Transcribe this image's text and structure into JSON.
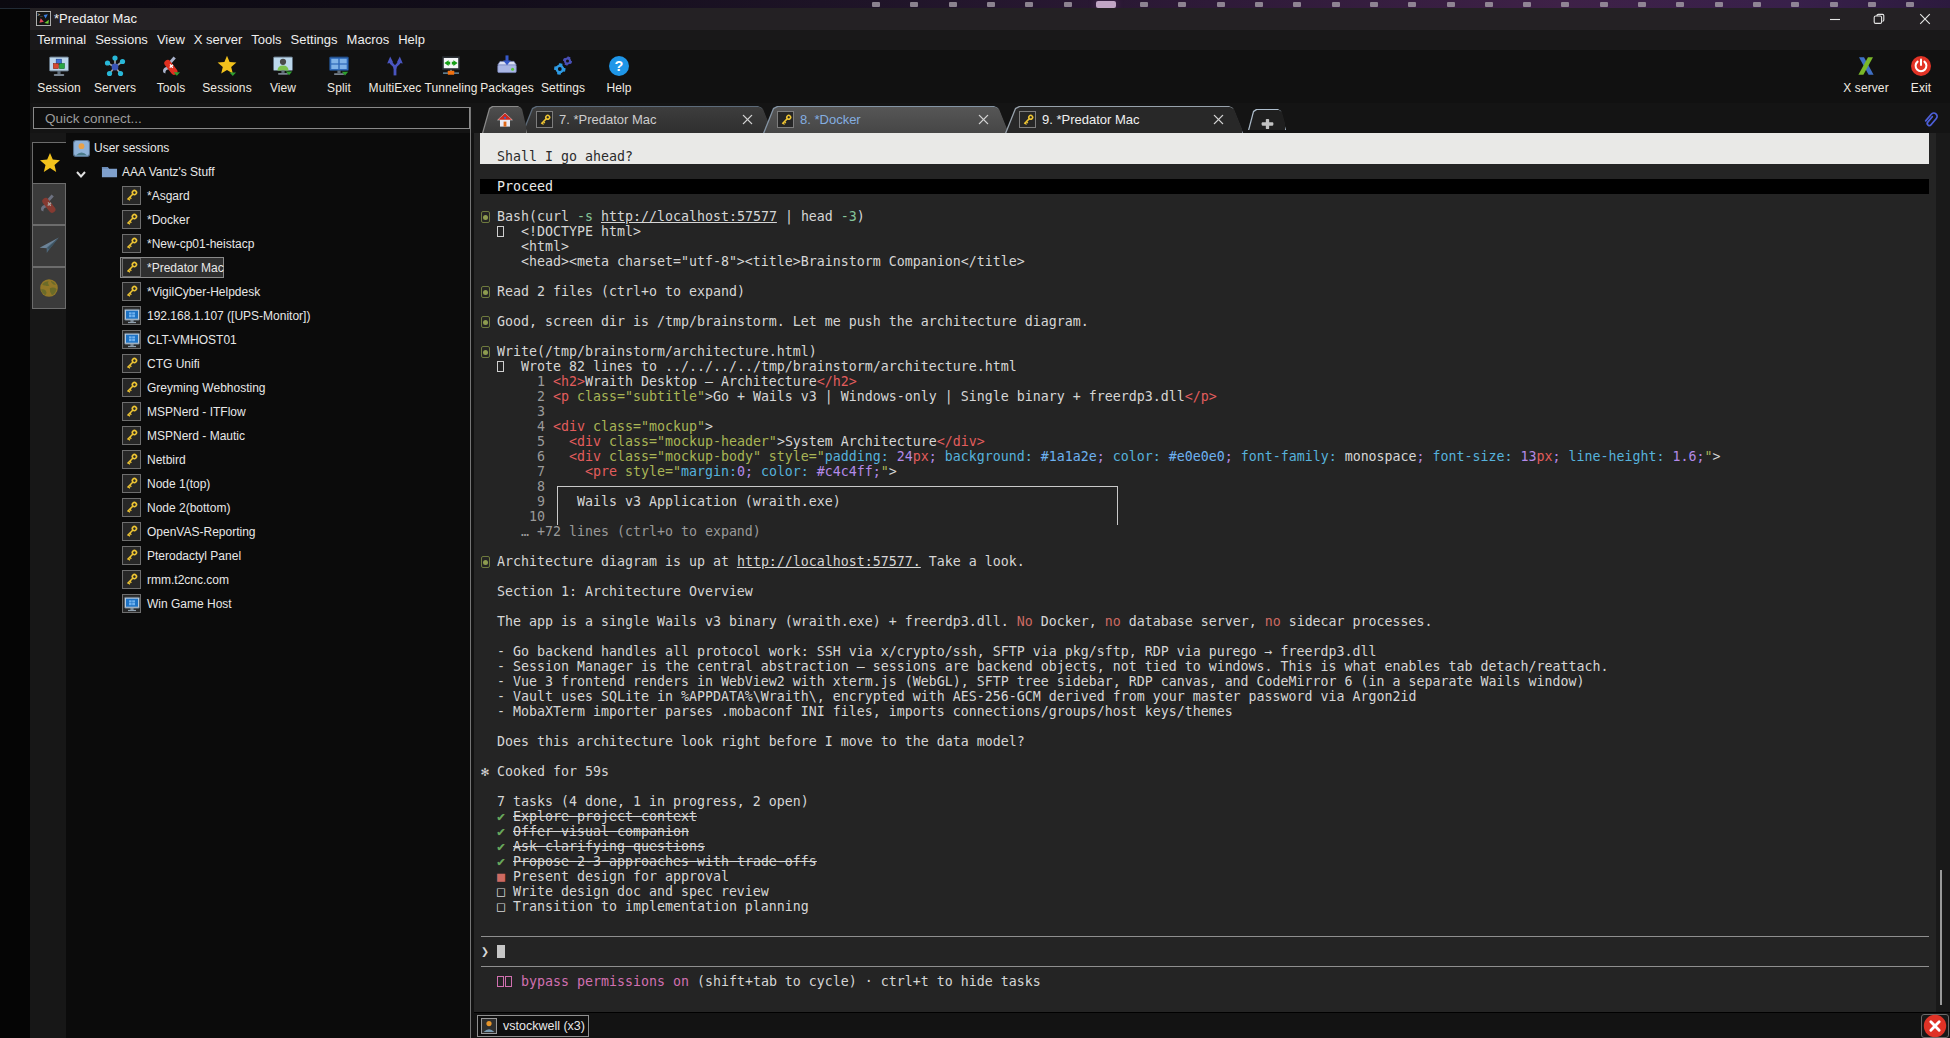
{
  "desktop": {
    "taskbar": {
      "icon_count": 28,
      "active_index": 6
    }
  },
  "titlebar": {
    "title": "*Predator Mac",
    "app_icon": "mobaxterm-logo",
    "controls": {
      "minimize": "minimize",
      "restore": "restore",
      "close": "close"
    }
  },
  "menubar": {
    "items": [
      "Terminal",
      "Sessions",
      "View",
      "X server",
      "Tools",
      "Settings",
      "Macros",
      "Help"
    ]
  },
  "toolbar": {
    "buttons": [
      {
        "label": "Session",
        "icon": "session"
      },
      {
        "label": "Servers",
        "icon": "servers"
      },
      {
        "label": "Tools",
        "icon": "tools"
      },
      {
        "label": "Sessions",
        "icon": "star"
      },
      {
        "label": "View",
        "icon": "view"
      },
      {
        "label": "Split",
        "icon": "split"
      },
      {
        "label": "MultiExec",
        "icon": "multiexec"
      },
      {
        "label": "Tunneling",
        "icon": "tunneling"
      },
      {
        "label": "Packages",
        "icon": "packages"
      },
      {
        "label": "Settings",
        "icon": "settings"
      },
      {
        "label": "Help",
        "icon": "help"
      }
    ],
    "right_buttons": [
      {
        "label": "X server",
        "icon": "xserver"
      },
      {
        "label": "Exit",
        "icon": "exit"
      }
    ]
  },
  "tabbar": {
    "quick_connect_placeholder": "Quick connect...",
    "tabs": [
      {
        "kind": "home",
        "icon": "home"
      },
      {
        "kind": "session",
        "icon": "key",
        "label": "7. *Predator Mac",
        "close": "×"
      },
      {
        "kind": "session",
        "icon": "key",
        "label": "8. *Docker",
        "close": "×",
        "highlight": true
      },
      {
        "kind": "session",
        "icon": "key",
        "label": "9. *Predator Mac",
        "close": "×",
        "active": true
      },
      {
        "kind": "new",
        "icon": "plus"
      }
    ],
    "attach_icon": "paperclip"
  },
  "sidebar": {
    "panel_tabs": [
      {
        "icon": "starplain",
        "name": "sessions",
        "active": true
      },
      {
        "icon": "knife",
        "name": "tools"
      },
      {
        "icon": "plane",
        "name": "macros"
      },
      {
        "icon": "globe",
        "name": "network"
      }
    ],
    "tree": {
      "root": {
        "label": "User sessions",
        "icon": "user-badge"
      },
      "folder": {
        "label": "AAA Vantz's Stuff",
        "icon": "folder",
        "expanded": true
      },
      "items": [
        {
          "label": "*Asgard",
          "icon": "key"
        },
        {
          "label": "*Docker",
          "icon": "key"
        },
        {
          "label": "*New-cp01-heistacp",
          "icon": "key"
        },
        {
          "label": "*Predator Mac",
          "icon": "key",
          "selected": true
        },
        {
          "label": "*VigilCyber-Helpdesk",
          "icon": "key"
        },
        {
          "label": "192.168.1.107 ([UPS-Monitor])",
          "icon": "rdp"
        },
        {
          "label": "CLT-VMHOST01",
          "icon": "rdp"
        },
        {
          "label": "CTG Unifi",
          "icon": "key"
        },
        {
          "label": "Greyming Webhosting",
          "icon": "key"
        },
        {
          "label": "MSPNerd - ITFlow",
          "icon": "key"
        },
        {
          "label": "MSPNerd - Mautic",
          "icon": "key"
        },
        {
          "label": "Netbird",
          "icon": "key"
        },
        {
          "label": "Node 1(top)",
          "icon": "key"
        },
        {
          "label": "Node 2(bottom)",
          "icon": "key"
        },
        {
          "label": "OpenVAS-Reporting",
          "icon": "key"
        },
        {
          "label": "Pterodactyl Panel",
          "icon": "key"
        },
        {
          "label": "rmm.t2cnc.com",
          "icon": "key"
        },
        {
          "label": "Win Game Host",
          "icon": "rdp"
        }
      ]
    }
  },
  "terminal": {
    "lines": [
      {
        "r": 1,
        "seg": [
          {
            "t": "  Shall I go ahead?",
            "c": "inv"
          }
        ],
        "cls": "on-white"
      },
      {
        "r": 3,
        "seg": [
          {
            "t": "  Proceed",
            "c": "wht"
          }
        ],
        "cls": "on-black"
      },
      {
        "r": 5,
        "seg": [
          {
            "g": "dot"
          },
          {
            "t": "Bash(curl "
          },
          {
            "t": "-s",
            "c": "grn"
          },
          {
            "t": " "
          },
          {
            "t": "http://localhost:57577",
            "u": 1
          },
          {
            "t": " | head "
          },
          {
            "t": "-3",
            "c": "grn"
          },
          {
            "t": ")"
          }
        ]
      },
      {
        "r": 6,
        "seg": [
          {
            "t": "  "
          },
          {
            "g": "tofu"
          },
          {
            "t": "<!DOCTYPE html>"
          }
        ]
      },
      {
        "r": 7,
        "seg": [
          {
            "t": "     <html>"
          }
        ]
      },
      {
        "r": 8,
        "seg": [
          {
            "t": "     <head><meta charset=\"utf-8\"><title>Brainstorm Companion</title>"
          }
        ]
      },
      {
        "r": 10,
        "seg": [
          {
            "g": "dot"
          },
          {
            "t": "Read 2 files (ctrl+o to expand)"
          }
        ]
      },
      {
        "r": 12,
        "seg": [
          {
            "g": "dot"
          },
          {
            "t": "Good, screen dir is /tmp/brainstorm. Let me push the architecture diagram."
          }
        ]
      },
      {
        "r": 14,
        "seg": [
          {
            "g": "dot"
          },
          {
            "t": "Write(/tmp/brainstorm/architecture.html)"
          }
        ]
      },
      {
        "r": 15,
        "seg": [
          {
            "t": "  "
          },
          {
            "g": "tofu"
          },
          {
            "t": "Wrote 82 lines to ../../../../tmp/brainstorm/architecture.html"
          }
        ]
      },
      {
        "r": 16,
        "seg": [
          {
            "t": "       1 ",
            "c": "dim"
          },
          {
            "t": "<h2>",
            "c": "tag"
          },
          {
            "t": "Wraith Desktop — Architecture"
          },
          {
            "t": "</h2>",
            "c": "tag"
          }
        ]
      },
      {
        "r": 17,
        "seg": [
          {
            "t": "       2 ",
            "c": "dim"
          },
          {
            "t": "<p",
            "c": "tag"
          },
          {
            "t": " class=\"subtitle\"",
            "c": "attr"
          },
          {
            "t": ">"
          },
          {
            "t": "Go + Wails v3 | Windows-only | Single binary + freerdp3.dll"
          },
          {
            "t": "</p>",
            "c": "tag"
          }
        ]
      },
      {
        "r": 18,
        "seg": [
          {
            "t": "       3",
            "c": "dim"
          }
        ]
      },
      {
        "r": 19,
        "seg": [
          {
            "t": "       4 ",
            "c": "dim"
          },
          {
            "t": "<div",
            "c": "tag"
          },
          {
            "t": " class=\"mockup\"",
            "c": "attr"
          },
          {
            "t": ">"
          }
        ]
      },
      {
        "r": 20,
        "seg": [
          {
            "t": "       5 ",
            "c": "dim"
          },
          {
            "t": "  "
          },
          {
            "t": "<div",
            "c": "tag"
          },
          {
            "t": " class=\"mockup-header\"",
            "c": "attr"
          },
          {
            "t": ">"
          },
          {
            "t": "System Architecture"
          },
          {
            "t": "</div>",
            "c": "tag"
          }
        ]
      },
      {
        "r": 21,
        "seg": [
          {
            "t": "       6 ",
            "c": "dim"
          },
          {
            "t": "  "
          },
          {
            "t": "<div",
            "c": "tag"
          },
          {
            "t": " class=\"mockup-body\"",
            "c": "attr"
          },
          {
            "t": " style=\"",
            "c": "attr"
          },
          {
            "t": "padding:",
            "c": "cyn"
          },
          {
            "t": " 24",
            "c": "pur"
          },
          {
            "t": "px",
            "c": "tag"
          },
          {
            "t": ";",
            "c": "pur"
          },
          {
            "t": " background:",
            "c": "cyn"
          },
          {
            "t": " #1a1a2e",
            "c": "blu"
          },
          {
            "t": ";",
            "c": "pur"
          },
          {
            "t": " color:",
            "c": "cyn"
          },
          {
            "t": " #e0e0e0",
            "c": "blu"
          },
          {
            "t": ";",
            "c": "pur"
          },
          {
            "t": " font-family:",
            "c": "cyn"
          },
          {
            "t": " monospace"
          },
          {
            "t": ";",
            "c": "pur"
          },
          {
            "t": " font-size:",
            "c": "cyn"
          },
          {
            "t": " 13",
            "c": "pur"
          },
          {
            "t": "px",
            "c": "tag"
          },
          {
            "t": ";",
            "c": "pur"
          },
          {
            "t": " line-height:",
            "c": "cyn"
          },
          {
            "t": " 1.6",
            "c": "pur"
          },
          {
            "t": ";",
            "c": "pur"
          },
          {
            "t": "\"",
            "c": "attr"
          },
          {
            "t": ">"
          }
        ]
      },
      {
        "r": 22,
        "seg": [
          {
            "t": "       7 ",
            "c": "dim"
          },
          {
            "t": "    "
          },
          {
            "t": "<pre",
            "c": "tag"
          },
          {
            "t": " style=\"",
            "c": "attr"
          },
          {
            "t": "margin:",
            "c": "cyn"
          },
          {
            "t": "0",
            "c": "pur"
          },
          {
            "t": ";",
            "c": "pur"
          },
          {
            "t": " color:",
            "c": "cyn"
          },
          {
            "t": " #c4c4ff",
            "c": "pur"
          },
          {
            "t": ";",
            "c": "pur"
          },
          {
            "t": "\"",
            "c": "attr"
          },
          {
            "t": ">"
          }
        ]
      },
      {
        "r": 23,
        "seg": [
          {
            "t": "       8",
            "c": "dim"
          }
        ]
      },
      {
        "r": 24,
        "seg": [
          {
            "t": "       9",
            "c": "dim"
          },
          {
            "t": "    "
          },
          {
            "t": "Wails v3 Application (wraith.exe)"
          }
        ]
      },
      {
        "r": 25,
        "seg": [
          {
            "t": "      10",
            "c": "dim"
          }
        ]
      },
      {
        "r": 26,
        "seg": [
          {
            "t": "     … +72 lines (ctrl+o to expand)",
            "c": "dim"
          }
        ]
      },
      {
        "r": 28,
        "seg": [
          {
            "g": "dot"
          },
          {
            "t": "Architecture diagram is up at "
          },
          {
            "t": "http://localhost:57577.",
            "u": 1
          },
          {
            "t": " Take a look."
          }
        ]
      },
      {
        "r": 30,
        "seg": [
          {
            "t": "  Section 1: Architecture Overview"
          }
        ]
      },
      {
        "r": 32,
        "seg": [
          {
            "t": "  The app is a single Wails v3 binary (wraith.exe) + freerdp3.dll. "
          },
          {
            "t": "No",
            "c": "red"
          },
          {
            "t": " Docker, "
          },
          {
            "t": "no",
            "c": "red"
          },
          {
            "t": " database server, "
          },
          {
            "t": "no",
            "c": "red"
          },
          {
            "t": " sidecar processes."
          }
        ]
      },
      {
        "r": 34,
        "seg": [
          {
            "t": "  - Go backend handles all protocol work: SSH via x/crypto/ssh, SFTP via pkg/sftp, RDP via purego → freerdp3.dll"
          }
        ]
      },
      {
        "r": 35,
        "seg": [
          {
            "t": "  - Session Manager is the central abstraction — sessions are backend objects, not tied to windows. This is what enables tab detach/reattach."
          }
        ]
      },
      {
        "r": 36,
        "seg": [
          {
            "t": "  - Vue 3 frontend renders in WebView2 with xterm.js (WebGL), SFTP tree sidebar, RDP canvas, and CodeMirror 6 (in a separate Wails window)"
          }
        ]
      },
      {
        "r": 37,
        "seg": [
          {
            "t": "  - Vault uses SQLite in %APPDATA%\\Wraith\\, encrypted with AES-256-GCM derived from your master password via Argon2id"
          }
        ]
      },
      {
        "r": 38,
        "seg": [
          {
            "t": "  - MobaXTerm importer parses .mobaconf INI files, imports connections/groups/host keys/themes"
          }
        ]
      },
      {
        "r": 40,
        "seg": [
          {
            "t": "  Does this architecture look right before I move to the data model?"
          }
        ]
      },
      {
        "r": 42,
        "seg": [
          {
            "t": "✻ Cooked for 59s"
          }
        ]
      },
      {
        "r": 44,
        "seg": [
          {
            "t": "  7 tasks (4 done, 1 in progress, 2 open)"
          }
        ]
      },
      {
        "r": 45,
        "seg": [
          {
            "t": "  "
          },
          {
            "t": "✔",
            "c": "chk"
          },
          {
            "t": " "
          },
          {
            "t": "Explore project context",
            "s": 1
          }
        ]
      },
      {
        "r": 46,
        "seg": [
          {
            "t": "  "
          },
          {
            "t": "✔",
            "c": "chk"
          },
          {
            "t": " "
          },
          {
            "t": "Offer visual companion",
            "s": 1
          }
        ]
      },
      {
        "r": 47,
        "seg": [
          {
            "t": "  "
          },
          {
            "t": "✔",
            "c": "chk"
          },
          {
            "t": " "
          },
          {
            "t": "Ask clarifying questions",
            "s": 1
          }
        ]
      },
      {
        "r": 48,
        "seg": [
          {
            "t": "  "
          },
          {
            "t": "✔",
            "c": "chk"
          },
          {
            "t": " "
          },
          {
            "t": "Propose 2-3 approaches with trade-offs",
            "s": 1
          }
        ]
      },
      {
        "r": 49,
        "seg": [
          {
            "t": "  "
          },
          {
            "t": "■",
            "c": "red"
          },
          {
            "t": " "
          },
          {
            "t": "Present design for approval"
          }
        ]
      },
      {
        "r": 50,
        "seg": [
          {
            "t": "  □ Write design doc and spec review"
          }
        ]
      },
      {
        "r": 51,
        "seg": [
          {
            "t": "  □ Transition to implementation planning"
          }
        ]
      },
      {
        "r": 54,
        "seg": [
          {
            "t": "❯"
          },
          {
            "t": " "
          },
          {
            "g": "cursor"
          }
        ]
      },
      {
        "r": 56,
        "seg": [
          {
            "t": "  "
          },
          {
            "g": "tofuA",
            "c": "pnk"
          },
          {
            "g": "tofuB",
            "c": "pnk"
          },
          {
            "t": "bypass permissions on",
            "c": "pnk"
          },
          {
            "t": " (shift+tab to cycle) · ctrl+t to hide tasks"
          }
        ]
      }
    ],
    "ascii_box_label": "Wails v3 Application (wraith.exe)"
  },
  "bottombar": {
    "session_button": {
      "label": "vstockwell (x3)",
      "icon": "user-photo"
    },
    "close_icon": "close-circle"
  }
}
